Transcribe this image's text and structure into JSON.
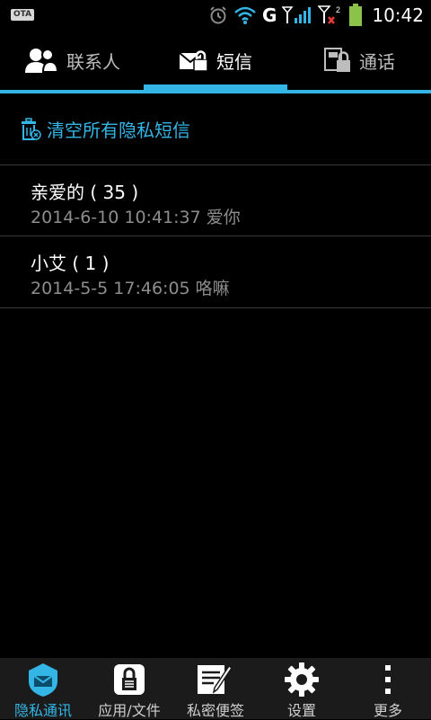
{
  "status_bar": {
    "carrier_badge": "OTA",
    "network_letter": "G",
    "time": "10:42",
    "icons": [
      "alarm-icon",
      "wifi-icon",
      "signal-icon",
      "signal2-icon",
      "battery-icon"
    ]
  },
  "tabs": [
    {
      "label": "联系人",
      "icon": "contacts-icon",
      "active": false
    },
    {
      "label": "短信",
      "icon": "sms-lock-icon",
      "active": true
    },
    {
      "label": "通话",
      "icon": "call-lock-icon",
      "active": false
    }
  ],
  "clear_action": {
    "label": "清空所有隐私短信",
    "icon": "trash-icon"
  },
  "messages": [
    {
      "name": "亲爱的 ( 35 )",
      "subtitle": "2014-6-10 10:41:37 爱你"
    },
    {
      "name": "小艾 ( 1 )",
      "subtitle": "2014-5-5 17:46:05 咯嘛"
    }
  ],
  "bottom_nav": [
    {
      "label": "隐私通讯",
      "icon": "privacy-comm-icon",
      "active": true
    },
    {
      "label": "应用/文件",
      "icon": "app-lock-icon",
      "active": false
    },
    {
      "label": "私密便签",
      "icon": "note-edit-icon",
      "active": false
    },
    {
      "label": "设置",
      "icon": "gear-icon",
      "active": false
    },
    {
      "label": "更多",
      "icon": "more-vert-icon",
      "active": false
    }
  ],
  "colors": {
    "accent": "#33b5e5",
    "background": "#000000",
    "nav_background": "#1b1b1b",
    "subtitle": "#8d8d8d"
  }
}
